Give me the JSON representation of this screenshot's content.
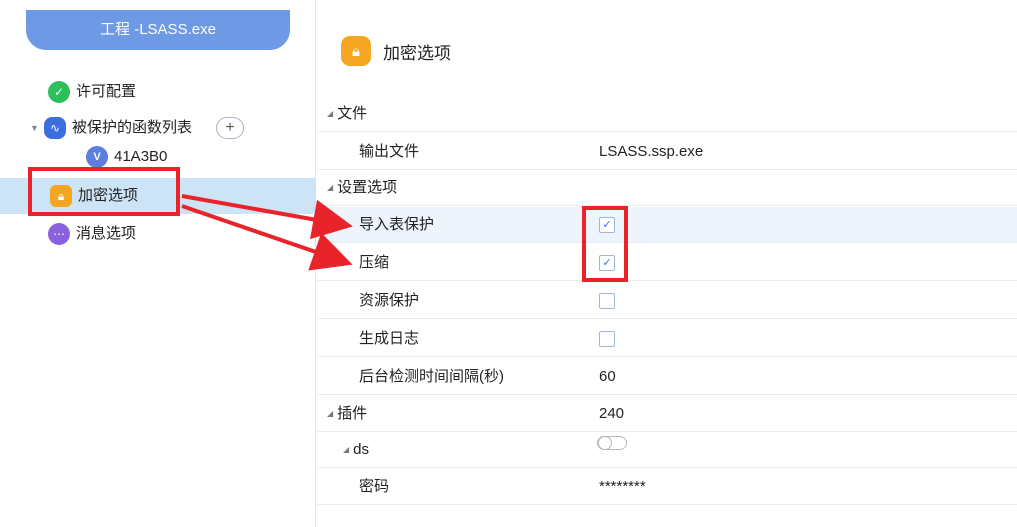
{
  "sidebar": {
    "project_title": "工程 -LSASS.exe",
    "items": {
      "license": {
        "label": "许可配置",
        "icon": "shield-check-icon"
      },
      "functions": {
        "label": "被保护的函数列表",
        "icon": "waveform-icon",
        "add": "+"
      },
      "function_sub": {
        "label": "41A3B0",
        "icon_text": "V"
      },
      "encrypt": {
        "label": "加密选项",
        "icon": "lock-icon"
      },
      "message": {
        "label": "消息选项",
        "icon": "chat-icon"
      }
    }
  },
  "main": {
    "title": "加密选项",
    "sections": {
      "file": {
        "label": "文件",
        "output_file": {
          "label": "输出文件",
          "value": "LSASS.ssp.exe"
        }
      },
      "settings": {
        "label": "设置选项",
        "import_protect": {
          "label": "导入表保护",
          "checked": true
        },
        "compress": {
          "label": "压缩",
          "checked": true
        },
        "resource_protect": {
          "label": "资源保护",
          "checked": false
        },
        "gen_log": {
          "label": "生成日志",
          "checked": false
        },
        "bg_interval": {
          "label": "后台检测时间间隔(秒)",
          "value": "60"
        }
      },
      "plugins": {
        "label": "插件",
        "value": "240",
        "ds": {
          "label": "ds",
          "enabled": false
        },
        "password": {
          "label": "密码",
          "value": "********"
        }
      }
    }
  },
  "colors": {
    "accent": "#6e99e4",
    "selected_bg": "#cde4f7",
    "annotation_red": "#e8232a",
    "encrypt_icon": "#f5a623"
  }
}
